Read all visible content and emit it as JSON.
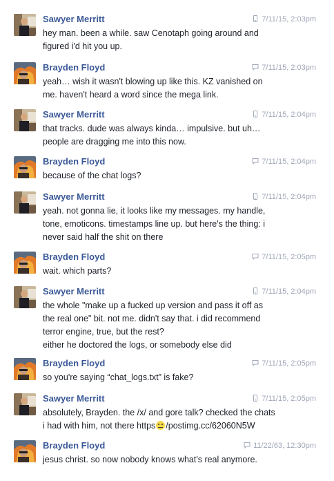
{
  "colors": {
    "name": "#3b5998",
    "timestamp": "#a0a7b8",
    "text": "#1d2129",
    "background": "#ffffff"
  },
  "icons": {
    "sawyer_ts": "phone-icon",
    "brayden_ts": "chat-bubble-icon"
  },
  "messages": [
    {
      "sender": "Sawyer Merritt",
      "timestamp": "7/11/15, 2:03pm",
      "lines": [
        "hey man. been a while. saw Cenotaph going around and",
        "figured i'd hit you up."
      ]
    },
    {
      "sender": "Brayden Floyd",
      "timestamp": "7/11/15, 2:03pm",
      "lines": [
        "yeah… wish it wasn't blowing up like this. KZ vanished on",
        "me. haven't heard a word since the mega link."
      ]
    },
    {
      "sender": "Sawyer Merritt",
      "timestamp": "7/11/15, 2:04pm",
      "lines": [
        "that tracks. dude was always kinda… impulsive. but uh…",
        "people are dragging me into this now."
      ]
    },
    {
      "sender": "Brayden Floyd",
      "timestamp": "7/11/15, 2:04pm",
      "lines": [
        "because of the chat logs?"
      ]
    },
    {
      "sender": "Sawyer Merritt",
      "timestamp": "7/11/15, 2:04pm",
      "lines": [
        "yeah. not gonna lie, it looks like my messages. my handle,",
        "tone, emoticons. timestamps line up. but here's the thing: i",
        "never said half the shit on there"
      ]
    },
    {
      "sender": "Brayden Floyd",
      "timestamp": "7/11/15, 2:05pm",
      "lines": [
        "wait. which parts?"
      ]
    },
    {
      "sender": "Sawyer Merritt",
      "timestamp": "7/11/15, 2:04pm",
      "lines": [
        "the whole \"make up a fucked up version and pass it off as",
        "the real one\" bit. not me. didn't say that. i did recommend",
        "terror engine, true, but the rest?",
        "either he doctored the logs, or somebody else did"
      ]
    },
    {
      "sender": "Brayden Floyd",
      "timestamp": "7/11/15, 2:05pm",
      "lines": [
        "so you're saying “chat_logs.txt” is fake?"
      ]
    },
    {
      "sender": "Sawyer Merritt",
      "timestamp": "7/11/15, 2:05pm",
      "lines": [
        "absolutely, Brayden. the /x/ and gore talk? checked the chats"
      ],
      "link_line_prefix": "i had with him, not there https",
      "link_line_suffix": "/postimg.cc/62060N5W"
    },
    {
      "sender": "Brayden Floyd",
      "timestamp": "11/22/63, 12:30pm",
      "lines": [
        "jesus christ. so now nobody knows what's real anymore."
      ]
    }
  ]
}
